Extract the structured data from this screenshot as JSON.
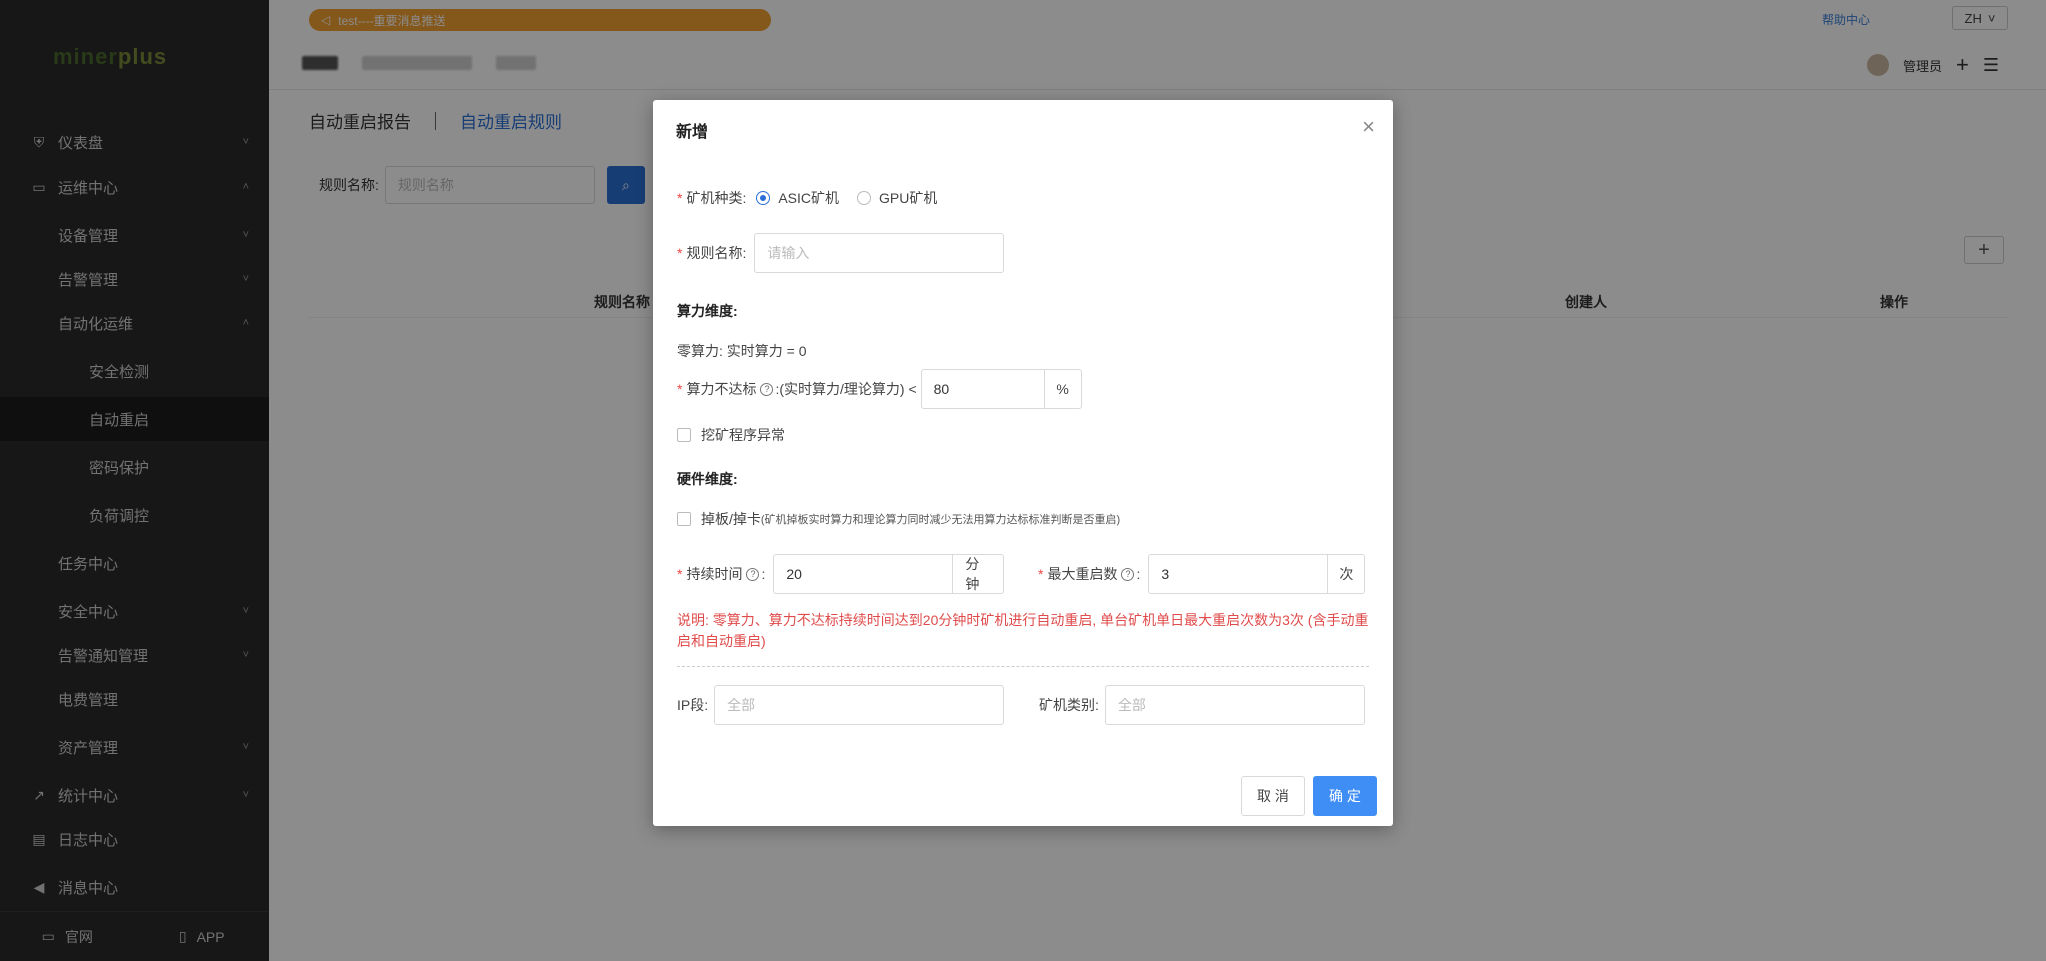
{
  "sidebar": {
    "logo": {
      "part1": "miner",
      "part2": "plus"
    },
    "items": [
      {
        "label": "仪表盘",
        "icon": "dashboard-icon",
        "chevron": "˅"
      },
      {
        "label": "运维中心",
        "icon": "monitor-icon",
        "chevron": "˄"
      },
      {
        "label": "设备管理",
        "chevron": "˅"
      },
      {
        "label": "告警管理",
        "chevron": "˅"
      },
      {
        "label": "自动化运维",
        "chevron": "˄"
      },
      {
        "label": "安全检测"
      },
      {
        "label": "自动重启"
      },
      {
        "label": "密码保护"
      },
      {
        "label": "负荷调控"
      },
      {
        "label": "任务中心"
      },
      {
        "label": "安全中心",
        "chevron": "˅"
      },
      {
        "label": "告警通知管理",
        "chevron": "˅"
      },
      {
        "label": "电费管理"
      },
      {
        "label": "资产管理",
        "chevron": "˅"
      },
      {
        "label": "统计中心",
        "icon": "chart-icon",
        "chevron": "˅"
      },
      {
        "label": "日志中心",
        "icon": "log-icon"
      },
      {
        "label": "消息中心",
        "icon": "speaker-icon"
      }
    ],
    "footer": {
      "website": "官网",
      "app": "APP"
    }
  },
  "topbar": {
    "notice": "test----重要消息推送",
    "help": "帮助中心",
    "lang": "ZH",
    "user": "管理员"
  },
  "page": {
    "tab_report": "自动重启报告",
    "tab_rules": "自动重启规则",
    "filter_label": "规则名称:",
    "filter_placeholder": "规则名称",
    "columns": {
      "name": "规则名称",
      "creator": "创建人",
      "actions": "操作"
    }
  },
  "modal": {
    "title": "新增",
    "miner_type_label": "矿机种类:",
    "miner_types": [
      "ASIC矿机",
      "GPU矿机"
    ],
    "selected_type": "ASIC矿机",
    "rule_name_label": "规则名称:",
    "rule_name_placeholder": "请输入",
    "hashrate_section": "算力维度:",
    "zero_hashrate": "零算力: 实时算力 = 0",
    "underperform_label": "算力不达标",
    "underperform_formula": ":(实时算力/理论算力) <",
    "underperform_value": "80",
    "underperform_unit": "%",
    "mining_error_label": "挖矿程序异常",
    "hardware_section": "硬件维度:",
    "board_drop_label": "掉板/掉卡",
    "board_drop_hint": "(矿机掉板实时算力和理论算力同时减少无法用算力达标标准判断是否重启)",
    "duration_label": "持续时间",
    "duration_value": "20",
    "duration_unit": "分钟",
    "max_restart_label": "最大重启数",
    "max_restart_value": "3",
    "max_restart_unit": "次",
    "note": "说明: 零算力、算力不达标持续时间达到20分钟时矿机进行自动重启, 单台矿机单日最大重启次数为3次 (含手动重启和自动重启)",
    "ip_label": "IP段:",
    "ip_placeholder": "全部",
    "category_label": "矿机类别:",
    "category_placeholder": "全部",
    "cancel": "取 消",
    "confirm": "确 定"
  },
  "colors": {
    "primary": "#3f8ef5",
    "link": "#2a6fd6",
    "warning": "#e04b4b",
    "sidebar": "#2b2b2b",
    "notice": "#f0a030"
  }
}
